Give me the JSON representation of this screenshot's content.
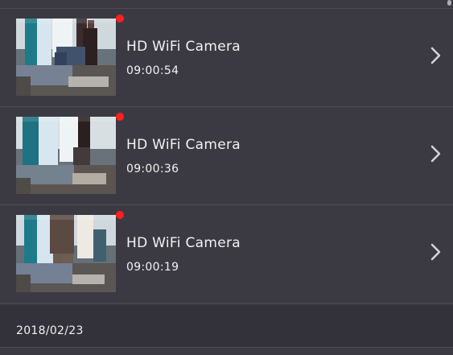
{
  "colors": {
    "background": "#3b3a43",
    "divider": "#4b4a55",
    "text": "#f2f2f2",
    "recording_dot": "#ff1f1f",
    "chevron": "#d4d4d8"
  },
  "events": [
    {
      "title": "HD WiFi Camera",
      "time": "09:00:54",
      "thumbnail": "camera-snapshot-room-person",
      "recording_indicator": "red-dot-icon",
      "action_icon": "chevron-right-icon"
    },
    {
      "title": "HD WiFi Camera",
      "time": "09:00:36",
      "thumbnail": "camera-snapshot-room-person",
      "recording_indicator": "red-dot-icon",
      "action_icon": "chevron-right-icon"
    },
    {
      "title": "HD WiFi Camera",
      "time": "09:00:19",
      "thumbnail": "camera-snapshot-room-person",
      "recording_indicator": "red-dot-icon",
      "action_icon": "chevron-right-icon"
    }
  ],
  "date_header": {
    "label": "2018/02/23"
  }
}
